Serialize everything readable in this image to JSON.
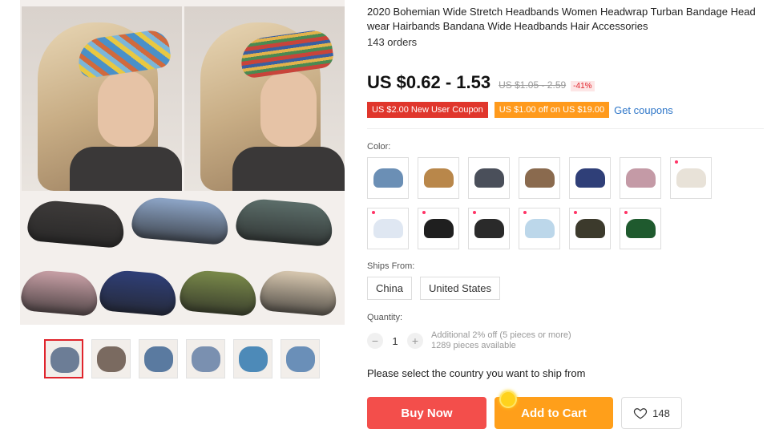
{
  "product": {
    "title": "2020 Bohemian Wide Stretch Headbands Women Headwrap Turban Bandage Head wear Hairbands Bandana Wide Headbands Hair Accessories",
    "orders": "143 orders",
    "price": "US $0.62 - 1.53",
    "old_price": "US $1.05 - 2.59",
    "discount": "-41%"
  },
  "coupons": {
    "new_user": "US $2.00 New User Coupon",
    "off": "US $1.00 off on US $19.00",
    "get_link": "Get coupons"
  },
  "color": {
    "label": "Color:",
    "swatches": [
      {
        "icon": "headband-floral-blue",
        "color": "#6b8fb5"
      },
      {
        "icon": "headband-stripe-multi",
        "color": "#b9874a"
      },
      {
        "icon": "headband-dark-leaf",
        "color": "#4a4f5a"
      },
      {
        "icon": "headband-stripe-warm",
        "color": "#8a6a4e"
      },
      {
        "icon": "headband-navy-floral",
        "color": "#2f3f78"
      },
      {
        "icon": "headband-pink-floral",
        "color": "#c49aa6"
      },
      {
        "icon": "headband-white-floral",
        "color": "#e8e2d8"
      },
      {
        "icon": "headband-white-dots",
        "color": "#dfe7f2"
      },
      {
        "icon": "headband-black-daisy",
        "color": "#1f1f1f"
      },
      {
        "icon": "headband-black-daisy-2",
        "color": "#2a2a2a"
      },
      {
        "icon": "headband-blue-daisy",
        "color": "#bcd7ea"
      },
      {
        "icon": "headband-olive-floral",
        "color": "#3c3a2c"
      },
      {
        "icon": "headband-green-dots",
        "color": "#1f5a2e"
      }
    ]
  },
  "ships_from": {
    "label": "Ships From:",
    "options": [
      "China",
      "United States"
    ]
  },
  "quantity": {
    "label": "Quantity:",
    "minus": "−",
    "value": "1",
    "plus": "+",
    "note_1": "Additional 2% off (5 pieces or more)",
    "note_2": "1289 pieces available"
  },
  "ship_note": "Please select the country you want to ship from",
  "actions": {
    "buy": "Buy Now",
    "cart": "Add to Cart",
    "wishlist_count": "148"
  },
  "gallery": {
    "band_colors": [
      "#3e3b3a",
      "#8ea6c8",
      "#5c6e6a",
      "#c8a0a6",
      "#2f3f78",
      "#7a8a4a",
      "#d8c8b0"
    ],
    "thumb_colors": [
      "#6c7d96",
      "#7a6a60",
      "#5a7aa0",
      "#7a90b0",
      "#4d8ab8",
      "#6a8fb8"
    ]
  },
  "colors": {
    "accent_red": "#e0242c",
    "buy_now": "#f34e4b",
    "add_to_cart": "#ff9f1a",
    "link_blue": "#2e76c8"
  }
}
